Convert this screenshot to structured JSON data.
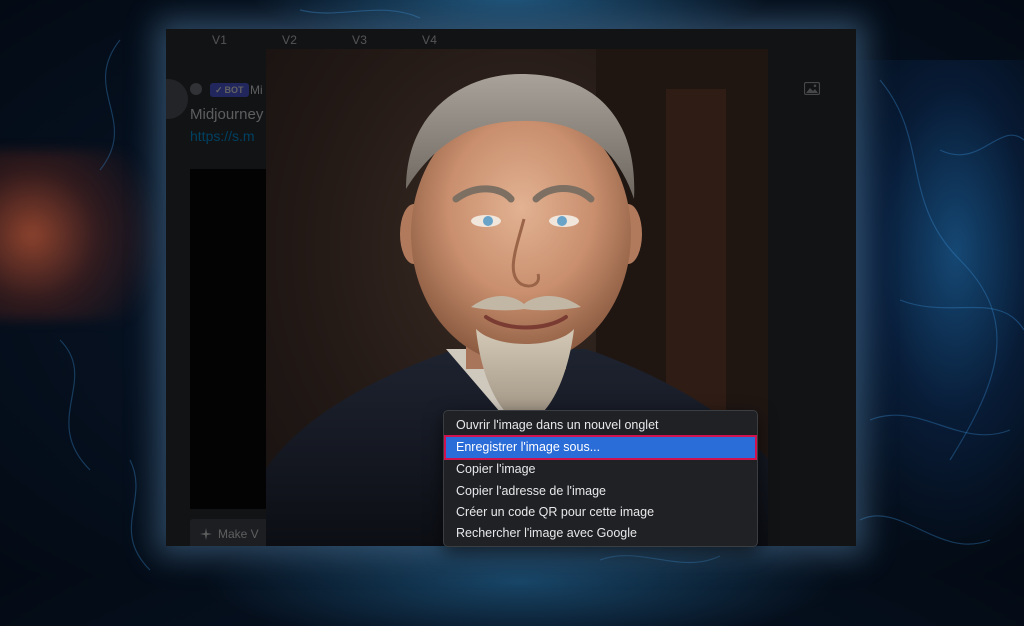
{
  "window": {
    "version_tabs": [
      "V1",
      "V2",
      "V3",
      "V4"
    ],
    "message": {
      "badge_label": "BOT",
      "author": "Mi",
      "title": "Midjourney",
      "link": "https://s.m"
    },
    "button_label": "Make V"
  },
  "context_menu": {
    "items": [
      "Ouvrir l'image dans un nouvel onglet",
      "Enregistrer l'image sous...",
      "Copier l'image",
      "Copier l'adresse de l'image",
      "Créer un code QR pour cette image",
      "Rechercher l'image avec Google"
    ],
    "selected_index": 1
  },
  "colors": {
    "highlight": "#2b6dd8",
    "highlight_border": "#d0124f",
    "menu_bg": "#1f2124"
  }
}
